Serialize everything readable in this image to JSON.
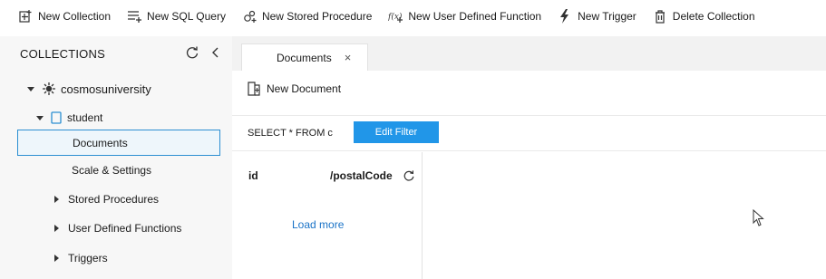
{
  "toolbar": {
    "new_collection": "New Collection",
    "new_sql_query": "New SQL Query",
    "new_stored_procedure": "New Stored Procedure",
    "new_udf": "New User Defined Function",
    "new_trigger": "New Trigger",
    "delete_collection": "Delete Collection"
  },
  "sidebar": {
    "title": "COLLECTIONS",
    "database": "cosmosuniversity",
    "collection": "student",
    "items": {
      "documents": "Documents",
      "scale_settings": "Scale & Settings",
      "stored_procedures": "Stored Procedures",
      "udfs": "User Defined Functions",
      "triggers": "Triggers"
    }
  },
  "tab": {
    "label": "Documents",
    "close": "×"
  },
  "actions": {
    "new_document": "New Document"
  },
  "filter": {
    "query": "SELECT * FROM c",
    "edit_label": "Edit Filter"
  },
  "documents": {
    "col_id": "id",
    "col_partition": "/postalCode",
    "load_more": "Load more"
  },
  "colors": {
    "accent": "#2196e8",
    "selection_border": "#2c8fd2",
    "link": "#1a73c7"
  }
}
